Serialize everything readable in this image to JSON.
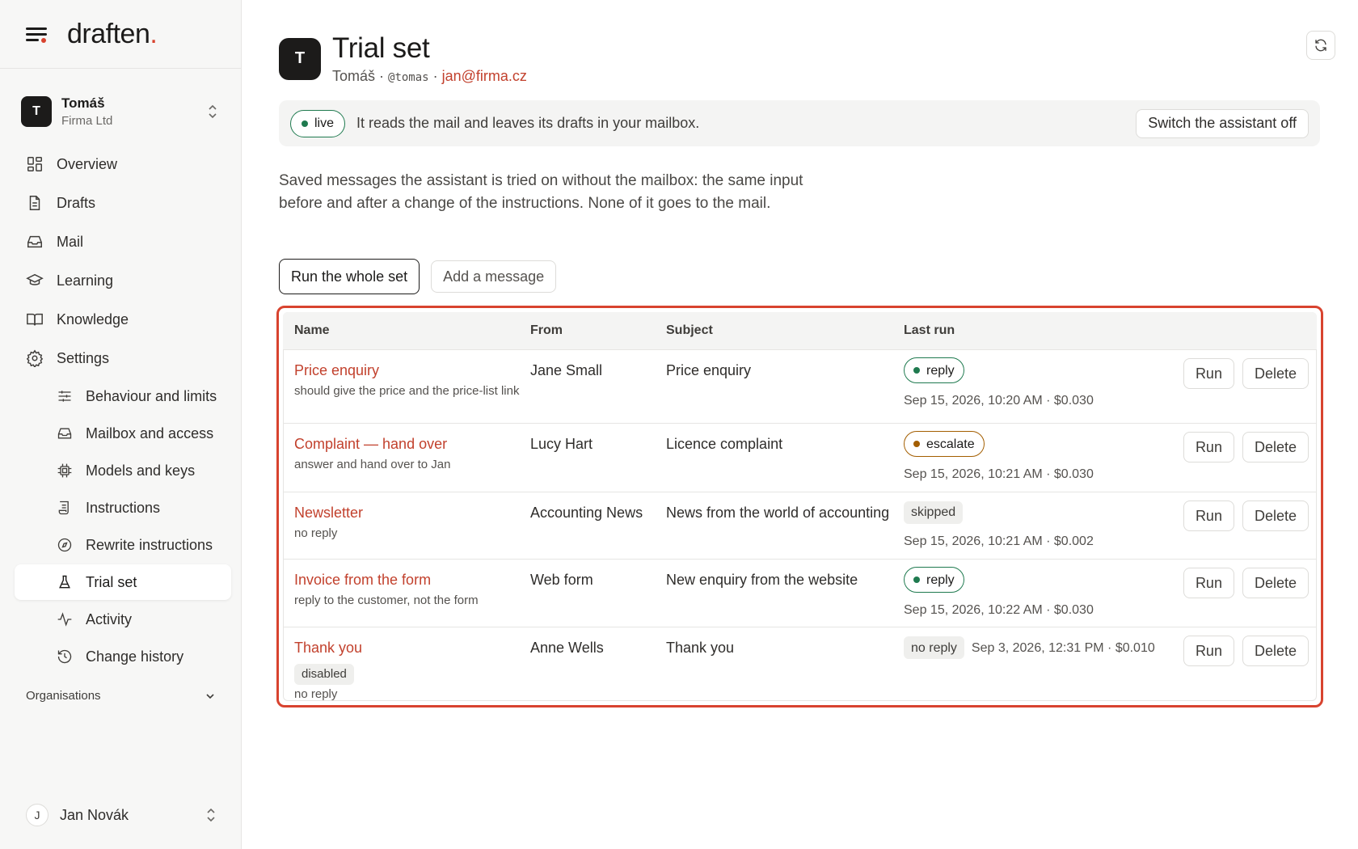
{
  "brand": {
    "name": "draften",
    "dot": "."
  },
  "account": {
    "initial": "T",
    "name": "Tomáš",
    "org": "Firma Ltd"
  },
  "nav": {
    "overview": "Overview",
    "drafts": "Drafts",
    "mail": "Mail",
    "learning": "Learning",
    "knowledge": "Knowledge",
    "settings": "Settings",
    "behaviour": "Behaviour and limits",
    "mailbox": "Mailbox and access",
    "models": "Models and keys",
    "instructions": "Instructions",
    "rewrite": "Rewrite instructions",
    "trial": "Trial set",
    "activity": "Activity",
    "history": "Change history"
  },
  "organisations_label": "Organisations",
  "user": {
    "initial": "J",
    "name": "Jan Novák"
  },
  "page": {
    "initial": "T",
    "title": "Trial set",
    "owner": "Tomáš",
    "sep1": " · ",
    "handle": "@tomas",
    "sep2": " · ",
    "email": "jan@firma.cz"
  },
  "banner": {
    "status": "live",
    "text": "It reads the mail and leaves its drafts in your mailbox.",
    "button": "Switch the assistant off"
  },
  "description": "Saved messages the assistant is tried on without the mailbox: the same input before and after a change of the instructions. None of it goes to the mail.",
  "actions": {
    "run_all": "Run the whole set",
    "add": "Add a message"
  },
  "table": {
    "headers": {
      "name": "Name",
      "from": "From",
      "subject": "Subject",
      "last_run": "Last run"
    },
    "run_label": "Run",
    "delete_label": "Delete",
    "rows": [
      {
        "name": "Price enquiry",
        "note": "should give the price and the price-list link",
        "from": "Jane Small",
        "subject": "Price enquiry",
        "status": "reply",
        "meta": "Sep 15, 2026, 10:20 AM · $0.030"
      },
      {
        "name": "Complaint — hand over",
        "note": "answer and hand over to Jan",
        "from": "Lucy Hart",
        "subject": "Licence complaint",
        "status": "escalate",
        "meta": "Sep 15, 2026, 10:21 AM · $0.030"
      },
      {
        "name": "Newsletter",
        "note": "no reply",
        "from": "Accounting News",
        "subject": "News from the world of accounting",
        "status": "skipped",
        "meta": "Sep 15, 2026, 10:21 AM · $0.002"
      },
      {
        "name": "Invoice from the form",
        "note": "reply to the customer, not the form",
        "from": "Web form",
        "subject": "New enquiry from the website",
        "status": "reply",
        "meta": "Sep 15, 2026, 10:22 AM · $0.030"
      },
      {
        "name": "Thank you",
        "badge": "disabled",
        "note": "no reply",
        "from": "Anne Wells",
        "subject": "Thank you",
        "status": "no reply",
        "meta": "Sep 3, 2026, 12:31 PM · $0.010"
      }
    ]
  },
  "colors": {
    "accent": "#d8432f",
    "link": "#c2412d",
    "green": "#1f7a4f",
    "amber": "#a35e00"
  }
}
